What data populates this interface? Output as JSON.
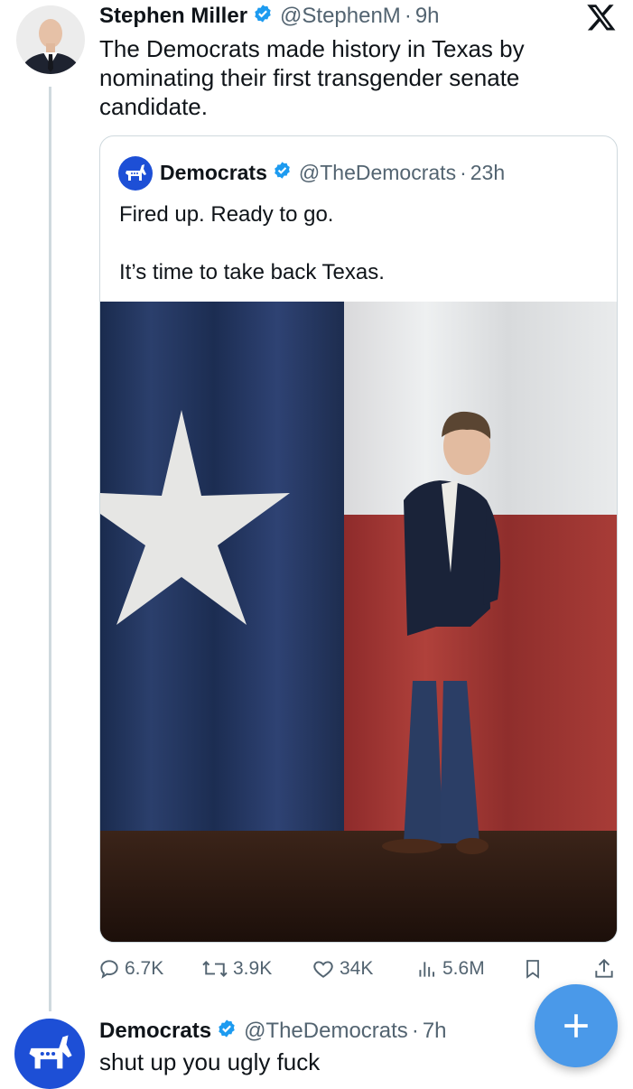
{
  "main_tweet": {
    "author_name": "Stephen Miller",
    "handle": "@StephenM",
    "time": "9h",
    "text_lines": [
      "The Democrats made history in Texas by",
      "nominating their first transgender senate",
      "candidate."
    ]
  },
  "quoted_tweet": {
    "author_name": "Democrats",
    "handle": "@TheDemocrats",
    "time": "23h",
    "text_line1": "Fired up. Ready to go.",
    "text_line2": "It’s time to take back Texas."
  },
  "actions": {
    "replies": "6.7K",
    "reposts": "3.9K",
    "likes": "34K",
    "views": "5.6M"
  },
  "reply_tweet": {
    "author_name": "Democrats",
    "handle": "@TheDemocrats",
    "time": "7h",
    "text": "shut up you ugly fuck"
  },
  "colors": {
    "verified": "#1d9bf0",
    "fab": "#4a99e9",
    "democrats_blue": "#1d4fd6",
    "secondary_text": "#536471"
  },
  "icons": [
    "x-logo-icon",
    "verified-badge-icon",
    "reply-icon",
    "repost-icon",
    "like-icon",
    "views-icon",
    "bookmark-icon",
    "share-icon",
    "compose-plus-icon",
    "donkey-logo-icon"
  ]
}
